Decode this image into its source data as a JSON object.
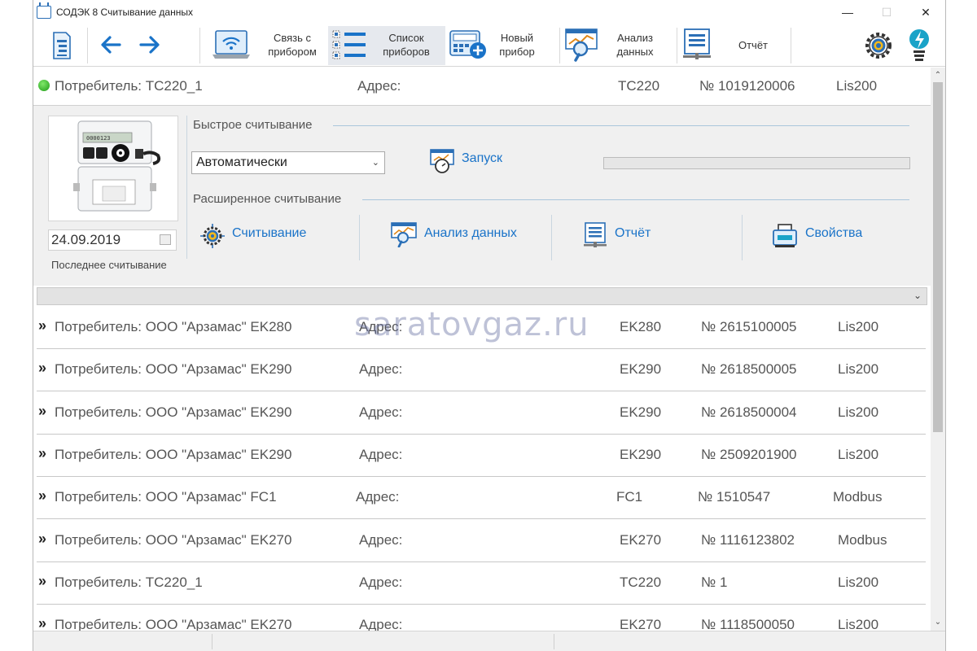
{
  "window": {
    "title": "СОДЭК 8 Считывание данных",
    "minimize": "—",
    "maximize": "☐",
    "close": "✕"
  },
  "toolbar": {
    "connection_label": "Связь с\nприбором",
    "device_list_label": "Список\nприборов",
    "new_device_label": "Новый\nприбор",
    "data_analysis_label": "Анализ\nданных",
    "report_label": "Отчёт",
    "back_icon": "←",
    "forward_icon": "→"
  },
  "expanded_device": {
    "consumer": "Потребитель: ТС220_1",
    "address": "Адрес:",
    "type": "TC220",
    "number": "№ 1019120006",
    "protocol": "Lis200",
    "status_color": "#1e9a16",
    "last_read_date": "24.09.2019",
    "last_read_label": "Последнее считывание",
    "quick_read_title": "Быстрое считывание",
    "quick_read_mode": "Автоматически",
    "start_label": "Запуск",
    "progress": 0,
    "extended_read_title": "Расширенное считывание",
    "actions": [
      {
        "label": "Считывание",
        "icon": "gear-target-icon"
      },
      {
        "label": "Анализ данных",
        "icon": "chart-magnifier-icon"
      },
      {
        "label": "Отчёт",
        "icon": "report-icon"
      },
      {
        "label": "Свойства",
        "icon": "properties-icon"
      }
    ]
  },
  "devices": [
    {
      "consumer": "Потребитель: ООО \"Арзамас\" EK280",
      "address": "Адрес:",
      "type": "EK280",
      "number": "№ 2615100005",
      "protocol": "Lis200"
    },
    {
      "consumer": "Потребитель: ООО \"Арзамас\" EK290",
      "address": "Адрес:",
      "type": "EK290",
      "number": "№ 2618500005",
      "protocol": "Lis200"
    },
    {
      "consumer": "Потребитель: ООО \"Арзамас\" EK290",
      "address": "Адрес:",
      "type": "EK290",
      "number": "№ 2618500004",
      "protocol": "Lis200"
    },
    {
      "consumer": "Потребитель: ООО \"Арзамас\" EK290",
      "address": "Адрес:",
      "type": "EK290",
      "number": "№ 2509201900",
      "protocol": "Lis200"
    },
    {
      "consumer": "Потребитель: ООО \"Арзамас\" FC1",
      "address": "Адрес:",
      "type": "FC1",
      "number": "№ 1510547",
      "protocol": "Modbus"
    },
    {
      "consumer": "Потребитель: ООО \"Арзамас\" EK270",
      "address": "Адрес:",
      "type": "EK270",
      "number": "№ 1116123802",
      "protocol": "Modbus"
    },
    {
      "consumer": "Потребитель: ТС220_1",
      "address": "Адрес:",
      "type": "TC220",
      "number": "№ 1",
      "protocol": "Lis200"
    },
    {
      "consumer": "Потребитель: ООО \"Арзамас\" EK270",
      "address": "Адрес:",
      "type": "EK270",
      "number": "№ 1118500050",
      "protocol": "Lis200"
    }
  ],
  "row_chevron": "»",
  "watermark": "saratovgaz.ru",
  "colors": {
    "accent": "#1a73c8",
    "status_online": "#1e9a16",
    "panel_bg": "#f0f0f0"
  }
}
